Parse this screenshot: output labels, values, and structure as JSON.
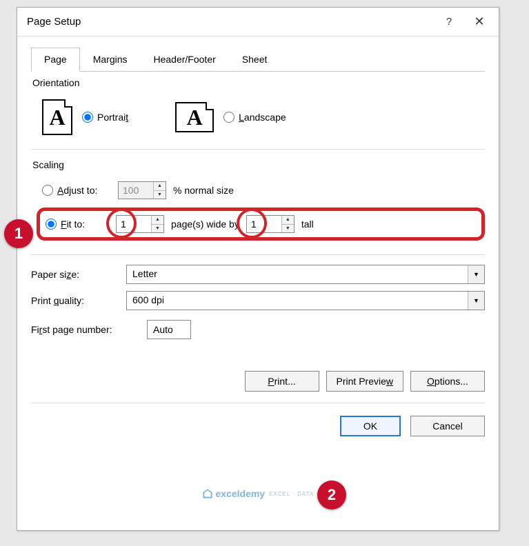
{
  "title": "Page Setup",
  "tabs": {
    "page": "Page",
    "margins": "Margins",
    "header_footer": "Header/Footer",
    "sheet": "Sheet"
  },
  "orientation": {
    "title": "Orientation",
    "portrait": "Portrait",
    "landscape": "Landscape",
    "selected": "portrait"
  },
  "scaling": {
    "title": "Scaling",
    "adjust_label": "Adjust to:",
    "adjust_value": "100",
    "adjust_suffix": "% normal size",
    "fit_label": "Fit to:",
    "fit_wide": "1",
    "fit_mid": "page(s) wide by",
    "fit_tall_value": "1",
    "fit_tall_suffix": "tall",
    "selected": "fit"
  },
  "paper": {
    "label": "Paper size:",
    "value": "Letter"
  },
  "quality": {
    "label": "Print quality:",
    "value": "600 dpi"
  },
  "first_page": {
    "label": "First page number:",
    "value": "Auto"
  },
  "buttons": {
    "print": "Print...",
    "preview": "Print Preview",
    "options": "Options...",
    "ok": "OK",
    "cancel": "Cancel"
  },
  "annotations": {
    "badge1": "1",
    "badge2": "2"
  },
  "watermark": {
    "name": "exceldemy",
    "sub": "EXCEL · DATA · BI"
  }
}
